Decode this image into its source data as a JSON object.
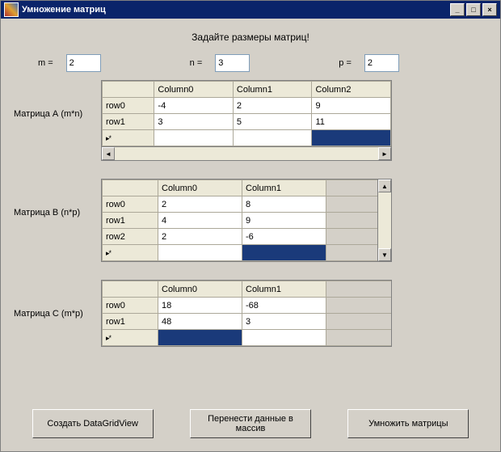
{
  "window": {
    "title": "Умножение матриц"
  },
  "prompt": "Задайте размеры матриц!",
  "dims": {
    "m_label": "m =",
    "m": "2",
    "n_label": "n =",
    "n": "3",
    "p_label": "p =",
    "p": "2"
  },
  "labels": {
    "A": "Матрица А (m*n)",
    "B": "Матрица B (n*p)",
    "C": "Матрица С (m*p)"
  },
  "gridA": {
    "cols": [
      "Column0",
      "Column1",
      "Column2"
    ],
    "rows": [
      {
        "h": "row0",
        "c": [
          "-4",
          "2",
          "9"
        ]
      },
      {
        "h": "row1",
        "c": [
          "3",
          "5",
          "11"
        ]
      }
    ]
  },
  "gridB": {
    "cols": [
      "Column0",
      "Column1"
    ],
    "rows": [
      {
        "h": "row0",
        "c": [
          "2",
          "8"
        ]
      },
      {
        "h": "row1",
        "c": [
          "4",
          "9"
        ]
      },
      {
        "h": "row2",
        "c": [
          "2",
          "-6"
        ]
      }
    ]
  },
  "gridC": {
    "cols": [
      "Column0",
      "Column1"
    ],
    "rows": [
      {
        "h": "row0",
        "c": [
          "18",
          "-68"
        ]
      },
      {
        "h": "row1",
        "c": [
          "48",
          "3"
        ]
      }
    ]
  },
  "buttons": {
    "create": "Создать DataGridView",
    "transfer": "Перенести данные в массив",
    "multiply": "Умножить матрицы"
  }
}
